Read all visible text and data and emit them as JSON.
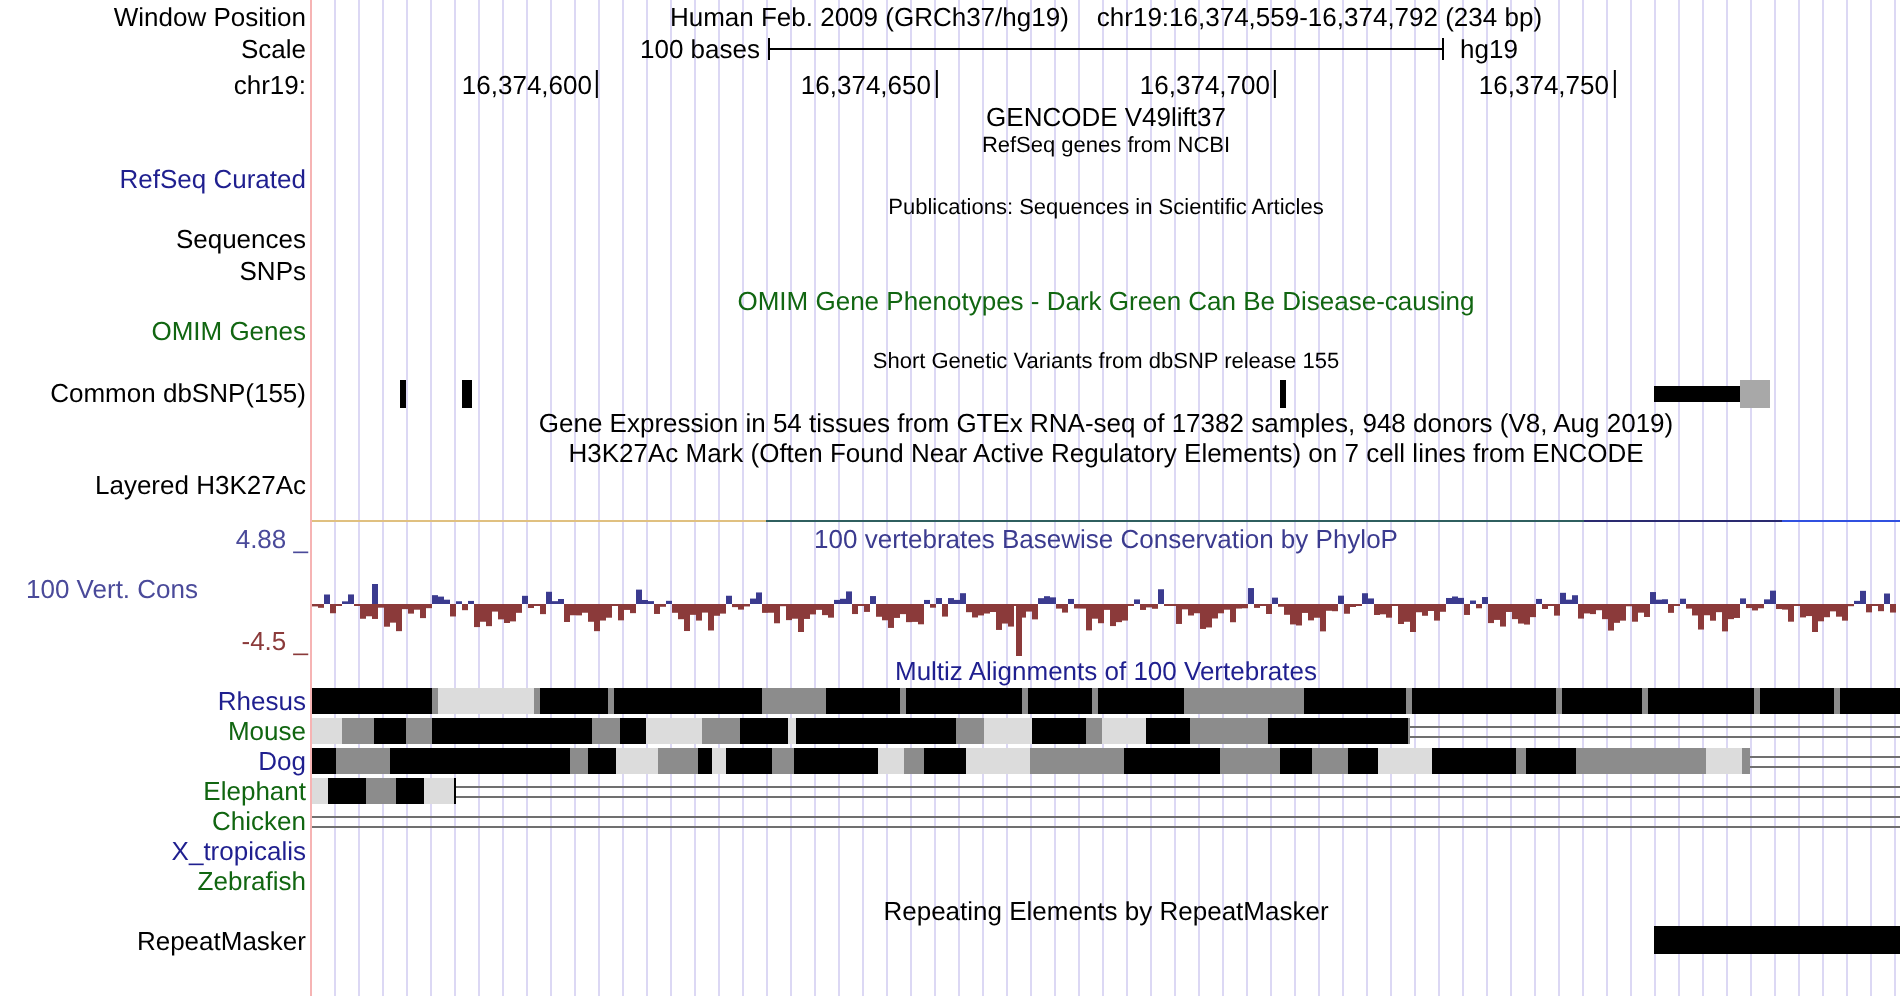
{
  "header": {
    "window_position_label": "Window Position",
    "assembly": "Human Feb. 2009 (GRCh37/hg19)",
    "position": "chr19:16,374,559-16,374,792 (234 bp)",
    "scale_label": "Scale",
    "scale_text": "100 bases",
    "scale_db": "hg19",
    "chrom_label": "chr19:",
    "ticks": [
      "16,374,600",
      "16,374,650",
      "16,374,700",
      "16,374,750"
    ]
  },
  "rows": [
    {
      "kind": "title",
      "text": "GENCODE V49lift37",
      "color": "#000000"
    },
    {
      "kind": "subtitle",
      "text": "RefSeq genes from NCBI",
      "color": "#000000"
    },
    {
      "kind": "label",
      "text": "RefSeq Curated",
      "color": "#1f1f8f"
    },
    {
      "kind": "subtitle",
      "text": "Publications: Sequences in Scientific Articles",
      "color": "#000000"
    },
    {
      "kind": "label",
      "text": "Sequences",
      "color": "#000000"
    },
    {
      "kind": "label",
      "text": "SNPs",
      "color": "#000000"
    },
    {
      "kind": "title",
      "text": "OMIM Gene Phenotypes - Dark Green Can Be Disease-causing",
      "color": "#116611"
    },
    {
      "kind": "label",
      "text": "OMIM Genes",
      "color": "#116611"
    },
    {
      "kind": "subtitle",
      "text": "Short Genetic Variants from dbSNP release 155",
      "color": "#000000"
    },
    {
      "kind": "snps",
      "text": "Common dbSNP(155)",
      "color": "#000000"
    },
    {
      "kind": "title",
      "text": "Gene Expression in 54 tissues from GTEx RNA-seq of 17382 samples, 948 donors (V8, Aug 2019)",
      "color": "#000000"
    },
    {
      "kind": "title",
      "text": "H3K27Ac Mark (Often Found Near Active Regulatory Elements) on 7 cell lines from ENCODE",
      "color": "#000000"
    },
    {
      "kind": "label",
      "text": "Layered H3K27Ac",
      "color": "#000000"
    }
  ],
  "conservation": {
    "max": "4.88 _",
    "label": "100 Vert. Cons",
    "min": "-4.5 _",
    "title": "100 vertebrates Basewise Conservation by PhyloP"
  },
  "multiz": {
    "title": "Multiz Alignments of 100 Vertebrates",
    "species": [
      {
        "name": "Rhesus",
        "color": "#1f1f8f"
      },
      {
        "name": "Mouse",
        "color": "#116611"
      },
      {
        "name": "Dog",
        "color": "#1f1f8f"
      },
      {
        "name": "Elephant",
        "color": "#116611"
      },
      {
        "name": "Chicken",
        "color": "#116611"
      },
      {
        "name": "X_tropicalis",
        "color": "#1f1f8f"
      },
      {
        "name": "Zebrafish",
        "color": "#116611"
      }
    ]
  },
  "repeats": {
    "title": "Repeating Elements by RepeatMasker",
    "label": "RepeatMasker"
  }
}
